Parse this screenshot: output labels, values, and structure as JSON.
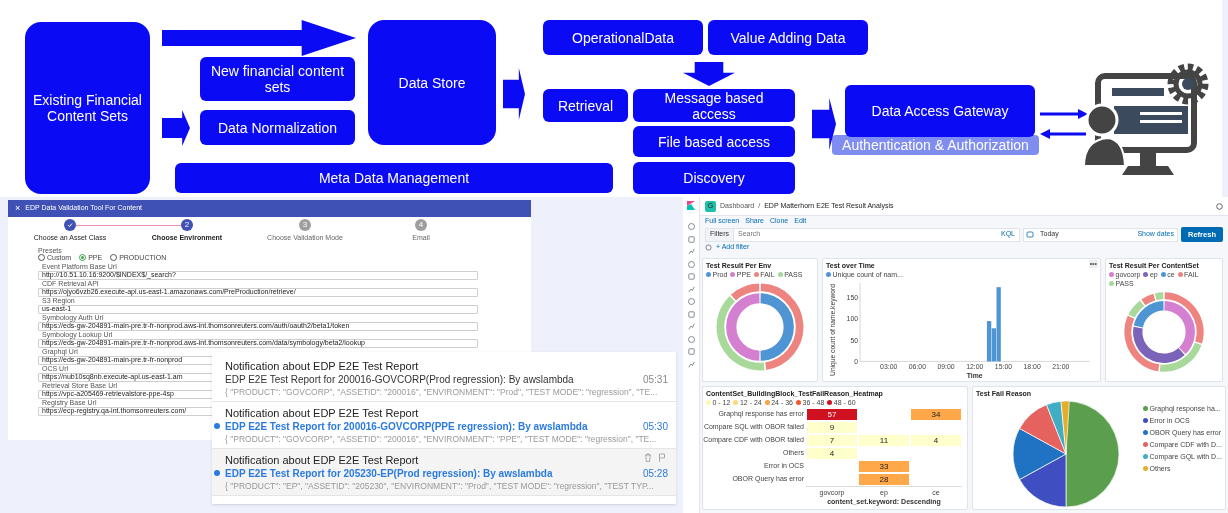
{
  "diagram": {
    "nodes": [
      {
        "label": "Existing Financial Content Sets"
      },
      {
        "label": "New financial content sets"
      },
      {
        "label": "Data Normalization"
      },
      {
        "label": "Data Store"
      },
      {
        "label": "Meta Data Management"
      },
      {
        "label": "OperationalData"
      },
      {
        "label": "Value Adding Data"
      },
      {
        "label": "Retrieval"
      },
      {
        "label": "Message based access"
      },
      {
        "label": "File based access"
      },
      {
        "label": "Discovery"
      },
      {
        "label": "Data Access Gateway"
      }
    ],
    "auth_band": "Authentication & Authorization"
  },
  "validation_tool": {
    "title": "EDP Data Validation Tool For Content",
    "close": "×",
    "steps": [
      {
        "label": "Choose an Asset Class",
        "completed": true,
        "active": false
      },
      {
        "label": "Choose Environment",
        "number": "2",
        "completed": false,
        "active": true
      },
      {
        "label": "Choose Validation Mode",
        "number": "3",
        "completed": false,
        "active": false
      },
      {
        "label": "Email",
        "number": "4",
        "completed": false,
        "active": false
      }
    ],
    "presets_label": "Presets",
    "presets": [
      {
        "label": "Custom",
        "selected": false
      },
      {
        "label": "PPE",
        "selected": true
      },
      {
        "label": "PRODUCTION",
        "selected": false
      }
    ],
    "fields": [
      {
        "label": "Event Platform Base Url",
        "value": "http://10.51.10.16:9200/$INDEX$/_search?"
      },
      {
        "label": "CDF Retrieval API",
        "value": "https://ojyo6vzb26.execute-api.us-east-1.amazonaws.com/PreProduction/retrieve/"
      },
      {
        "label": "S3 Region",
        "value": "us-east-1"
      },
      {
        "label": "Symbology Auth Url",
        "value": "https://eds-gw-204891-main-pre.tr-fr-nonprod.aws-int.thomsonreuters.com/auth/oauth2/beta1/token"
      },
      {
        "label": "Symbology Lookup Url",
        "value": "https://eds-gw-204891-main-pre.tr-fr-nonprod.aws-int.thomsonreuters.com/data/symbology/beta2/lookup"
      },
      {
        "label": "Graphql Url",
        "value": "https://eds-gw-204891-main-pre.tr-fr-nonprod"
      },
      {
        "label": "OCS Url",
        "value": "https://nub10sq8nb.execute-api.us-east-1.am"
      },
      {
        "label": "Retrieval Store Base Url",
        "value": "https://vpc-a205469-retrievalstore-ppe-4sp"
      },
      {
        "label": "Registry Base Url",
        "value": "https://ecp-registry.qa-int.thomsonreuters.com/"
      }
    ]
  },
  "notifications": [
    {
      "title": "Notification about EDP E2E Test Report",
      "subject": "EDP E2E Test Report for 200016-GOVCORP(Prod regression): By awslambda",
      "time": "05:31",
      "preview": "{ \"PRODUCT\": \"GOVCORP\", \"ASSETID\": \"200016\", \"ENVIRONMENT\": \"Prod\", \"TEST MODE\": \"regression\", \"TE...",
      "unread": false,
      "hovered": false
    },
    {
      "title": "Notification about EDP E2E Test Report",
      "subject": "EDP E2E Test Report for 200016-GOVCORP(PPE regression): By awslambda",
      "time": "05:30",
      "preview": "{ \"PRODUCT\": \"GOVCORP\", \"ASSETID\": \"200016\", \"ENVIRONMENT\": \"PPE\", \"TEST MODE\": \"regression\", \"TE...",
      "unread": true,
      "hovered": false
    },
    {
      "title": "Notification about EDP E2E Test Report",
      "subject": "EDP E2E Test Report for 205230-EP(Prod regression): By awslambda",
      "time": "05:28",
      "preview": "{ \"PRODUCT\": \"EP\", \"ASSETID\": \"205230\", \"ENVIRONMENT\": \"Prod\", \"TEST MODE\": \"regression\", \"TEST TYP...",
      "unread": true,
      "hovered": true
    }
  ],
  "dashboard": {
    "space_badge": "G",
    "breadcrumbs": [
      "Dashboard",
      "EDP Matterhorn E2E Test Result Analysis"
    ],
    "breadcrumb_separator": "/",
    "actions": [
      "Full screen",
      "Share",
      "Clone",
      "Edit"
    ],
    "filters_label": "Filters",
    "search_placeholder": "Search",
    "kql": "KQL",
    "date_value": "Today",
    "show_dates": "Show dates",
    "refresh": "Refresh",
    "add_filter": "+ Add filter",
    "env_panel": {
      "title": "Test Result Per Env",
      "legend": [
        {
          "label": "Prod",
          "color": "#4f95d4"
        },
        {
          "label": "PPE",
          "color": "#d57fd0"
        },
        {
          "label": "FAIL",
          "color": "#ee8480"
        },
        {
          "label": "PASS",
          "color": "#a8d89a"
        }
      ]
    },
    "time_panel": {
      "title": "Test over Time",
      "menu": "•••",
      "chart_data": {
        "type": "bar",
        "xlabel": "Time",
        "ylabel": "Unique count of name.keyword",
        "x": [
          13.5,
          14.0,
          14.5
        ],
        "series": [
          {
            "name": "Unique count of nam...",
            "color": "#4f95d4",
            "values": [
              95,
              78,
              175
            ]
          }
        ],
        "xlim": [
          0,
          24
        ],
        "ylim": [
          0,
          185
        ],
        "xticks": [
          {
            "value": 3,
            "label": "03:00"
          },
          {
            "value": 6,
            "label": "06:00"
          },
          {
            "value": 9,
            "label": "09:00"
          },
          {
            "value": 12,
            "label": "12:00"
          },
          {
            "value": 15,
            "label": "15:00"
          },
          {
            "value": 18,
            "label": "18:00"
          },
          {
            "value": 21,
            "label": "21:00"
          }
        ],
        "yticks": [
          0,
          50,
          100,
          150
        ]
      }
    },
    "contentset_panel": {
      "title": "Test Result Per ContentSet",
      "legend": [
        {
          "label": "govcorp",
          "color": "#d57fd0"
        },
        {
          "label": "ep",
          "color": "#7a63b8"
        },
        {
          "label": "ce",
          "color": "#4f95d4"
        },
        {
          "label": "FAIL",
          "color": "#ee8480"
        },
        {
          "label": "PASS",
          "color": "#a8d89a"
        }
      ]
    },
    "heatmap_panel": {
      "title": "ContentSet_BuildingBlock_TestFailReason_Heatmap",
      "legend": [
        {
          "label": "0 - 12",
          "color": "#fff7b0"
        },
        {
          "label": "12 - 24",
          "color": "#fed976"
        },
        {
          "label": "24 - 36",
          "color": "#fd9f3f"
        },
        {
          "label": "36 - 48",
          "color": "#f4562a"
        },
        {
          "label": "48 - 60",
          "color": "#d0111f"
        }
      ],
      "rows": [
        {
          "label": "Graphql response has error",
          "cells": [
            {
              "value": "57",
              "color": "#d0111f"
            },
            null,
            {
              "value": "34",
              "color": "#fea84a"
            }
          ]
        },
        {
          "label": "Compare SQL with OBOR failed",
          "cells": [
            {
              "value": "9",
              "color": "#ffffcc"
            },
            null,
            null
          ]
        },
        {
          "label": "Compare CDF with OBOR failed",
          "cells": [
            {
              "value": "7",
              "color": "#ffffcc"
            },
            {
              "value": "11",
              "color": "#ffffcc"
            },
            {
              "value": "4",
              "color": "#ffffcc"
            }
          ]
        },
        {
          "label": "Others",
          "cells": [
            {
              "value": "4",
              "color": "#ffffcc"
            },
            null,
            null
          ]
        },
        {
          "label": "Error in OCS",
          "cells": [
            null,
            {
              "value": "33",
              "color": "#fea84a"
            },
            null
          ]
        },
        {
          "label": "OBOR Query has error",
          "cells": [
            null,
            {
              "value": "28",
              "color": "#fea84a"
            },
            null
          ]
        }
      ],
      "x_axis_labels": [
        "govcorp",
        "ep",
        "ce"
      ],
      "axis_title": "content_set.keyword: Descending"
    },
    "fail_panel": {
      "title": "Test Fail Reason",
      "legend": [
        {
          "label": "Graphql response ha...",
          "color": "#5b9e4d"
        },
        {
          "label": "Error in OCS",
          "color": "#3f4fc2"
        },
        {
          "label": "OBOR Query has error",
          "color": "#2073c3"
        },
        {
          "label": "Compare CDF with D...",
          "color": "#e5625f"
        },
        {
          "label": "Compare GQL with D...",
          "color": "#3fadc4"
        },
        {
          "label": "Others",
          "color": "#e6ad2c"
        }
      ]
    }
  }
}
